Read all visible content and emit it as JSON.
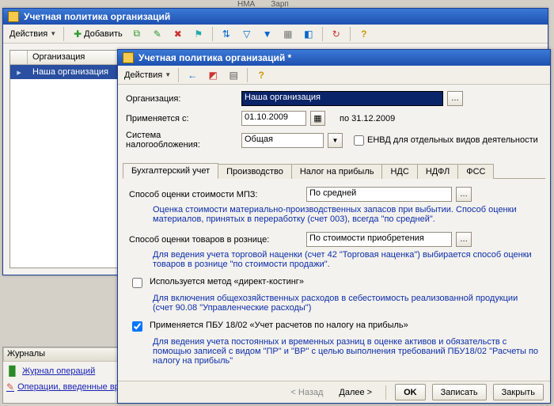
{
  "bg": {
    "word1": "HMA",
    "word2": "Зарп"
  },
  "outer": {
    "title": "Учетная политика организаций",
    "actions_label": "Действия",
    "add_label": "Добавить",
    "columns": {
      "icon": "",
      "org": "Организация"
    },
    "row": {
      "org": "Наша организация"
    }
  },
  "journals": {
    "title": "Журналы",
    "link1": "Журнал операций",
    "link2": "Операции, введенные вручную"
  },
  "inner": {
    "title": "Учетная политика организаций *",
    "actions_label": "Действия",
    "fields": {
      "org_label": "Организация:",
      "org_value": "Наша организация",
      "applies_label": "Применяется с:",
      "applies_value": "01.10.2009",
      "applies_to": "по 31.12.2009",
      "tax_label": "Система налогообложения:",
      "tax_value": "Общая",
      "envd_label": "ЕНВД для отдельных видов деятельности"
    },
    "tabs": {
      "buh": "Бухгалтерский учет",
      "prod": "Производство",
      "profit": "Налог на прибыль",
      "nds": "НДС",
      "ndfl": "НДФЛ",
      "fss": "ФСС"
    },
    "buh": {
      "mpz_label": "Способ оценки стоимости МПЗ:",
      "mpz_value": "По средней",
      "mpz_help": "Оценка стоимости материально-производственных запасов при выбытии. Способ оценки материалов, принятых в переработку (счет 003), всегда \"по средней\".",
      "retail_label": "Способ оценки товаров в рознице:",
      "retail_value": "По стоимости приобретения",
      "retail_help": "Для ведения учета торговой наценки (счет 42 \"Торговая наценка\") выбирается способ оценки товаров в рознице \"по стоимости продажи\".",
      "direct_label": "Используется метод «директ-костинг»",
      "direct_help": "Для включения общехозяйственных расходов в себестоимость реализованной продукции (счет 90.08 \"Управленческие расходы\")",
      "pbu_label": "Применяется ПБУ 18/02 «Учет расчетов по налогу на прибыль»",
      "pbu_help": "Для ведения учета постоянных и временных разниц в оценке активов и обязательств с помощью записей с видом \"ПР\" и \"ВР\" с целью выполнения требований ПБУ18/02 \"Расчеты по налогу на прибыль\""
    },
    "footer": {
      "back": "< Назад",
      "next": "Далее >",
      "ok": "OK",
      "save": "Записать",
      "close": "Закрыть"
    }
  }
}
